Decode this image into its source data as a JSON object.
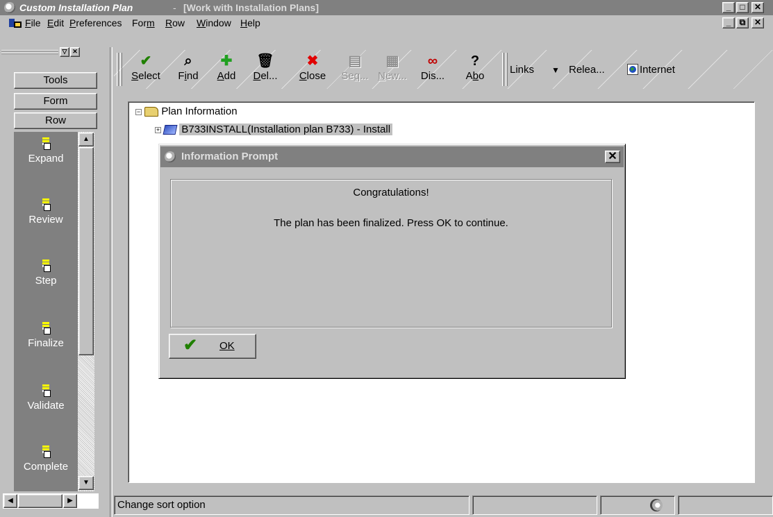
{
  "window": {
    "app_title": "Custom Installation Plan",
    "title_separator": "-",
    "subtitle": "[Work with Installation Plans]"
  },
  "menu": {
    "items": [
      {
        "key": "F",
        "rest": "ile"
      },
      {
        "key": "E",
        "rest": "dit"
      },
      {
        "key": "P",
        "rest": "references"
      },
      {
        "pre": "For",
        "key": "m",
        "rest": ""
      },
      {
        "key": "R",
        "rest": "ow"
      },
      {
        "key": "W",
        "rest": "indow"
      },
      {
        "key": "H",
        "rest": "elp"
      }
    ]
  },
  "left_panel": {
    "tabs": [
      "Tools",
      "Form",
      "Row"
    ],
    "items": [
      "Expand",
      "Review",
      "Step",
      "Finalize",
      "Validate",
      "Complete"
    ]
  },
  "toolbar": {
    "buttons": [
      {
        "icon": "checkmark-icon",
        "pre": "",
        "key": "S",
        "rest": "elect",
        "enabled": true,
        "color": "#208000"
      },
      {
        "icon": "find-icon",
        "pre": "F",
        "key": "i",
        "rest": "nd",
        "enabled": true,
        "color": "#000000"
      },
      {
        "icon": "plus-icon",
        "pre": "",
        "key": "A",
        "rest": "dd",
        "enabled": true,
        "color": "#20a020"
      },
      {
        "icon": "trash-icon",
        "pre": "",
        "key": "D",
        "rest": "el...",
        "enabled": true,
        "color": "#000000"
      },
      {
        "icon": "x-icon",
        "pre": "",
        "key": "C",
        "rest": "lose",
        "enabled": true,
        "color": "#e00000"
      },
      {
        "icon": "sequence-icon",
        "pre": "Se",
        "key": "q",
        "rest": "...",
        "enabled": false,
        "color": "#909090"
      },
      {
        "icon": "new-icon",
        "pre": "",
        "key": "N",
        "rest": "ew...",
        "enabled": false,
        "color": "#909090"
      },
      {
        "icon": "display-icon",
        "pre": "Dis...",
        "key": "",
        "rest": "",
        "enabled": true,
        "color": "#c00000"
      },
      {
        "icon": "about-icon",
        "pre": "A",
        "key": "b",
        "rest": "o",
        "enabled": true,
        "color": "#000000"
      }
    ],
    "links_label": "Links",
    "release_label": "Relea...",
    "internet_label": "Internet"
  },
  "tree": {
    "root_label": "Plan Information",
    "child_label": "B733INSTALL(Installation plan B733) - Install"
  },
  "dialog": {
    "title": "Information Prompt",
    "heading": "Congratulations!",
    "message": "The plan has been finalized.  Press OK to continue.",
    "ok_label": "OK"
  },
  "status": {
    "text": "Change sort option"
  }
}
